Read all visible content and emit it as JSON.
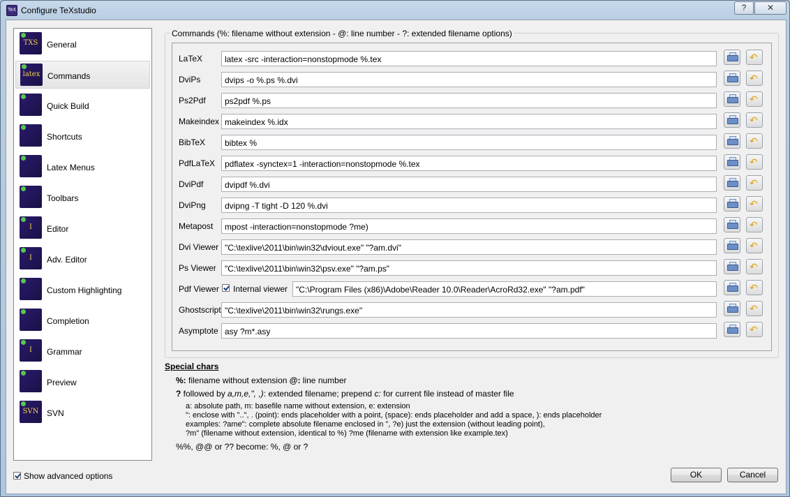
{
  "window": {
    "title": "Configure TeXstudio",
    "help": "?",
    "close": "✕",
    "app_icon": "txs-app-icon"
  },
  "sidebar": {
    "items": [
      {
        "label": "General",
        "icon": "TXS"
      },
      {
        "label": "Commands",
        "icon": "latex"
      },
      {
        "label": "Quick Build",
        "icon": ""
      },
      {
        "label": "Shortcuts",
        "icon": ""
      },
      {
        "label": "Latex Menus",
        "icon": ""
      },
      {
        "label": "Toolbars",
        "icon": ""
      },
      {
        "label": "Editor",
        "icon": "I"
      },
      {
        "label": "Adv. Editor",
        "icon": "I"
      },
      {
        "label": "Custom Highlighting",
        "icon": ""
      },
      {
        "label": "Completion",
        "icon": ""
      },
      {
        "label": "Grammar",
        "icon": "I"
      },
      {
        "label": "Preview",
        "icon": ""
      },
      {
        "label": "SVN",
        "icon": "SVN"
      }
    ],
    "selected": "Commands"
  },
  "show_advanced": {
    "label": "Show advanced options",
    "checked": true
  },
  "commands": {
    "group_title": "Commands (%: filename without extension - @: line number - ?: extended filename options)",
    "rows": [
      {
        "label": "LaTeX",
        "value": "latex -src -interaction=nonstopmode %.tex"
      },
      {
        "label": "DviPs",
        "value": "dvips -o %.ps %.dvi"
      },
      {
        "label": "Ps2Pdf",
        "value": "ps2pdf %.ps"
      },
      {
        "label": "Makeindex",
        "value": "makeindex %.idx"
      },
      {
        "label": "BibTeX",
        "value": "bibtex %"
      },
      {
        "label": "PdfLaTeX",
        "value": "pdflatex -synctex=1 -interaction=nonstopmode %.tex"
      },
      {
        "label": "DviPdf",
        "value": "dvipdf %.dvi"
      },
      {
        "label": "DviPng",
        "value": "dvipng -T tight -D 120 %.dvi"
      },
      {
        "label": "Metapost",
        "value": "mpost -interaction=nonstopmode ?me)"
      },
      {
        "label": "Dvi Viewer",
        "value": "\"C:\\texlive\\2011\\bin\\win32\\dviout.exe\" \"?am.dvi\""
      },
      {
        "label": "Ps Viewer",
        "value": "\"C:\\texlive\\2011\\bin\\win32\\psv.exe\" \"?am.ps\""
      },
      {
        "label": "Pdf Viewer",
        "value": "\"C:\\Program Files (x86)\\Adobe\\Reader 10.0\\Reader\\AcroRd32.exe\" \"?am.pdf\"",
        "internal_viewer_label": "Internal viewer",
        "internal_viewer_checked": true
      },
      {
        "label": "Ghostscript",
        "value": "\"C:\\texlive\\2011\\bin\\win32\\rungs.exe\""
      },
      {
        "label": "Asymptote",
        "value": "asy ?m*.asy"
      }
    ],
    "browse_icon": "printer-icon",
    "reset_icon": "undo-arrow-icon"
  },
  "special_chars": {
    "title": "Special chars",
    "line1_bold": "%:",
    "line1": " filename without extension ",
    "line1_bold2": "@:",
    "line1_rest": " line number",
    "line2_bold": "?",
    "line2_a": " followed by ",
    "line2_i": "a,m,e,\", ,)",
    "line2_b": ": extended filename; prepend ",
    "line2_i2": "c:",
    "line2_c": " for current file instead of master file",
    "detail1": "a: absolute path, m: basefile name without extension, e: extension",
    "detail2": "\": enclose with \"..\", . (point): ends placeholder with a point, (space): ends placeholder and add a space, ): ends placeholder",
    "detail3": "examples: ?ame\": complete absolute filename enclosed in \", ?e) just the extension (without leading point),",
    "detail4": "?m\" (filename without extension, identical to %) ?me (filename with extension like example.tex)",
    "line_last": "%%, @@ or ?? become: %, @ or ?"
  },
  "buttons": {
    "ok": "OK",
    "cancel": "Cancel"
  }
}
